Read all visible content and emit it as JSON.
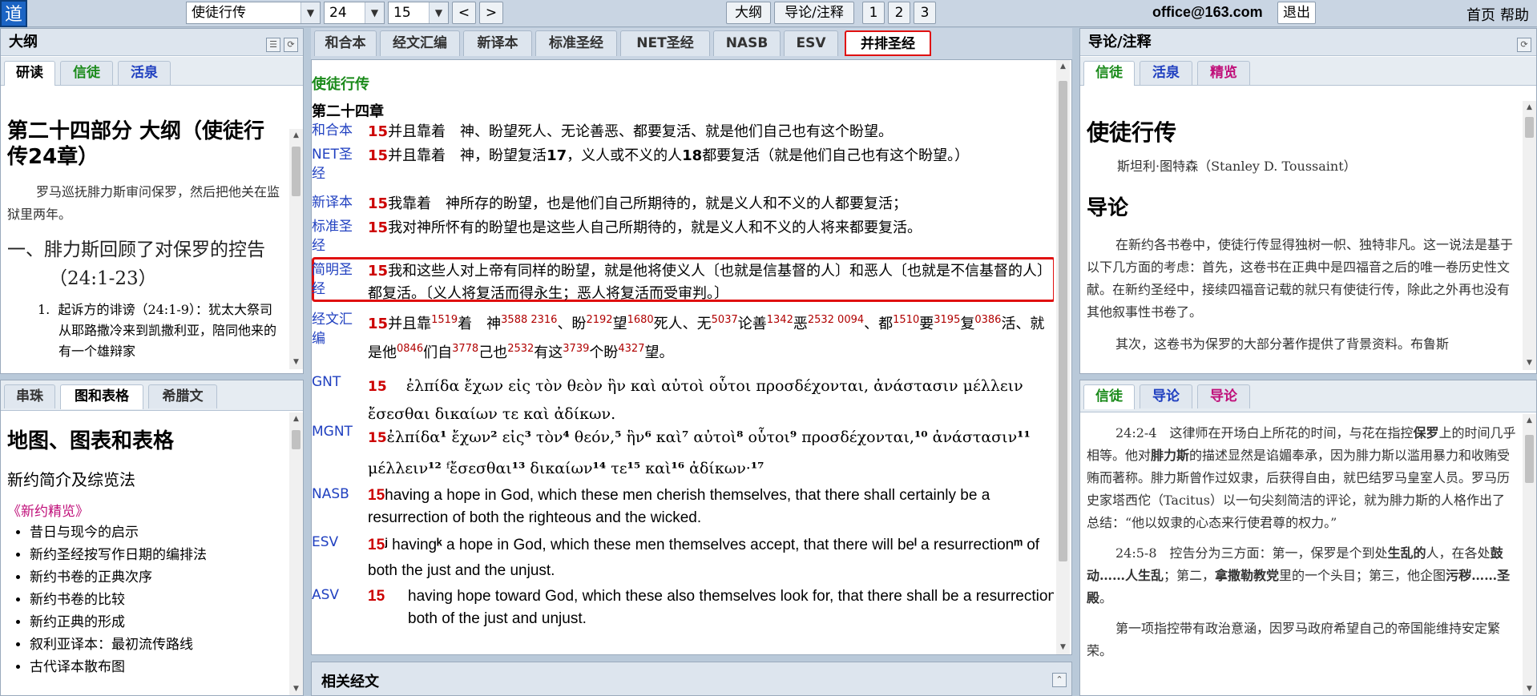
{
  "topbar": {
    "logo": "道",
    "book": "使徒行传",
    "chapter": "24",
    "verse": "15",
    "prev": "<",
    "next": ">",
    "outline_btn": "大纲",
    "intro_btn": "导论/注释",
    "layout_1": "1",
    "layout_2": "2",
    "layout_3": "3",
    "email": "office@163.com",
    "logout": "退出",
    "home": "首页",
    "help": "帮助"
  },
  "left_top": {
    "title": "大纲",
    "tabs": [
      "研读",
      "信徒",
      "活泉"
    ],
    "heading": "第二十四部分 大纲（使徒行传24章）",
    "intro": "罗马巡抚腓力斯审问保罗，然后把他关在监狱里两年。",
    "section1": "一、腓力斯回顾了对保罗的控告（24:1-23）",
    "item1": "起诉方的诽谤（24:1-9）：犹太大祭司从耶路撒冷来到凯撒利亚，陪同他来的有一个雄辩家"
  },
  "left_bottom": {
    "tabs": [
      "串珠",
      "图和表格",
      "希腊文"
    ],
    "heading": "地图、图表和表格",
    "subheading": "新约简介及综览法",
    "link": "《新约精览》",
    "items": [
      "昔日与现今的启示",
      "新约圣经按写作日期的编排法",
      "新约书卷的正典次序",
      "新约书卷的比较",
      "新约正典的形成",
      "叙利亚译本：最初流传路线",
      "古代译本散布图"
    ]
  },
  "center": {
    "tabs": [
      "和合本",
      "经文汇编",
      "新译本",
      "标准圣经",
      "NET圣经",
      "NASB",
      "ESV",
      "并排圣经"
    ],
    "book": "使徒行传",
    "chapter": "第二十四章",
    "related": "相关经文"
  },
  "right_top": {
    "title": "导论/注释",
    "tabs": [
      "信徒",
      "活泉",
      "精览"
    ],
    "heading": "使徒行传",
    "author": "斯坦利·图特森（Stanley D. Toussaint）",
    "section": "导论",
    "p1": "在新约各书卷中，使徒行传显得独树一帜、独特非凡。这一说法是基于以下几方面的考虑：首先，这卷书在正典中是四福音之后的唯一卷历史性文献。在新约圣经中，接续四福音记载的就只有使徒行传，除此之外再也没有其他叙事性书卷了。",
    "p2": "其次，这卷书为保罗的大部分著作提供了背景资料。布鲁斯"
  },
  "right_bottom": {
    "tabs": [
      "信徒",
      "导论",
      "导论"
    ],
    "p1a": "24:2-4　这律师在开场白上所花的时间，与花在指控",
    "p1b": "保罗",
    "p1c": "上的时间几乎相等。他对",
    "p1d": "腓力斯",
    "p1e": "的描述显然是谄媚奉承，因为腓力斯以滥用暴力和收贿受贿而著称。腓力斯曾作过奴隶，后获得自由，就巴结罗马皇室人员。罗马历史家塔西佗（Tacitus）以一句尖刻简洁的评论，就为腓力斯的人格作出了总结：“他以奴隶的心态来行使君尊的权力。”",
    "p2a": "24:5-8　控告分为三方面：第一，保罗是个到处",
    "p2b": "生乱的",
    "p2c": "人，在各处",
    "p2d": "鼓动……人生乱",
    "p2e": "；第二，",
    "p2f": "拿撒勒教党",
    "p2g": "里的一个头目；第三，他企图",
    "p2h": "污秽……圣殿",
    "p2i": "。",
    "p3": "第一项指控带有政治意涵，因罗马政府希望自己的帝国能维持安定繁荣。"
  }
}
